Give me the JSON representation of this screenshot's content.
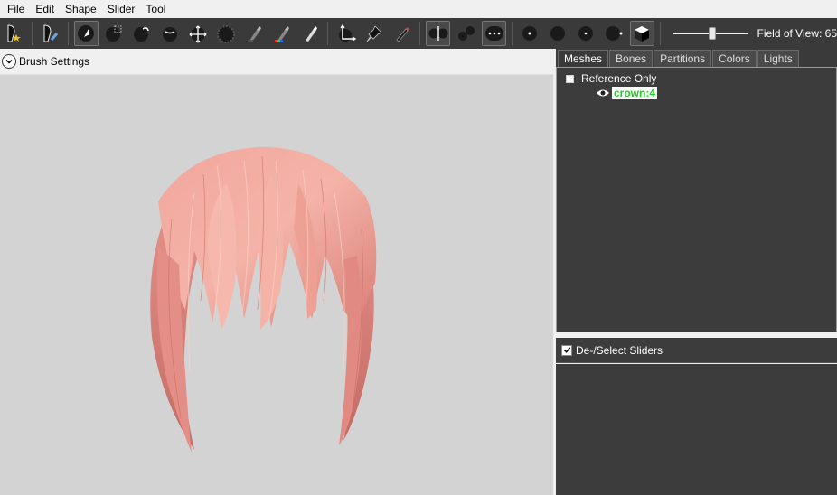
{
  "menu": [
    "File",
    "Edit",
    "Shape",
    "Slider",
    "Tool"
  ],
  "toolbar": {
    "field_of_view_label": "Field of View: 65",
    "field_of_view_value": 65
  },
  "brush_panel": {
    "title": "Brush Settings"
  },
  "tabs": [
    "Meshes",
    "Bones",
    "Partitions",
    "Colors",
    "Lights"
  ],
  "tree": {
    "root_label": "Reference Only",
    "mesh_name": "crown:4"
  },
  "sliders": {
    "toggle_label": "De-/Select Sliders"
  },
  "colors": {
    "toolbar_bg": "#3a3a3a",
    "viewport_bg": "#d3d3d3",
    "hair": "#e8968e",
    "mesh_name": "#22cc22"
  }
}
